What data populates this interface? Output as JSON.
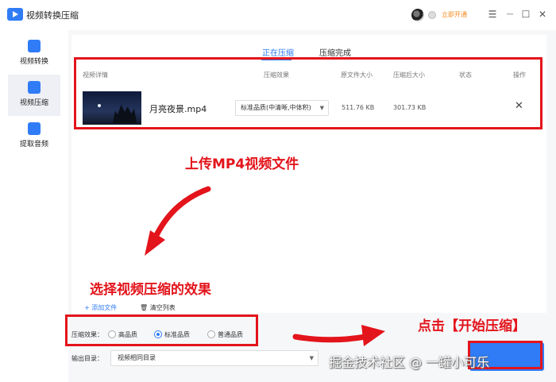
{
  "titlebar": {
    "app_title": "视频转换压缩",
    "vip_label": "立即开通"
  },
  "window_controls": {
    "menu": "☰",
    "minimize": "—",
    "maximize": "☐",
    "close": "✕"
  },
  "sidebar": {
    "items": [
      {
        "label": "视频转换",
        "icon": "convert-icon",
        "active": false
      },
      {
        "label": "视频压缩",
        "icon": "compress-icon",
        "active": true
      },
      {
        "label": "提取音频",
        "icon": "audio-icon",
        "active": false
      }
    ]
  },
  "tabs": [
    {
      "label": "正在压缩",
      "active": true
    },
    {
      "label": "压缩完成",
      "active": false
    }
  ],
  "table": {
    "headers": [
      "视频详情",
      "压缩效果",
      "原文件大小",
      "压缩后大小",
      "状态",
      "操作"
    ],
    "rows": [
      {
        "filename": "月亮夜景.mp4",
        "quality": "标准品质(中清晰,中体积)",
        "original_size": "511.76 KB",
        "compressed_size": "301.73 KB",
        "status": "",
        "action_icon": "close-icon"
      }
    ]
  },
  "toolbar": {
    "add_label": "+ 添加文件",
    "clear_label": "清空列表"
  },
  "settings": {
    "effect_label": "压缩效果：",
    "options": [
      "高品质",
      "标准品质",
      "普通品质"
    ],
    "selected": "标准品质",
    "output_label": "输出目录：",
    "output_value": "视频相同目录"
  },
  "annotations": {
    "upload": "上传MP4视频文件",
    "choose": "选择视频压缩的效果",
    "click_start": "点击【开始压缩】",
    "watermark": "掘金技术社区 @ 一罐小可乐"
  },
  "colors": {
    "accent": "#2f7cf6",
    "annotation_red": "#e3141b",
    "vip_orange": "#f28a1b"
  }
}
